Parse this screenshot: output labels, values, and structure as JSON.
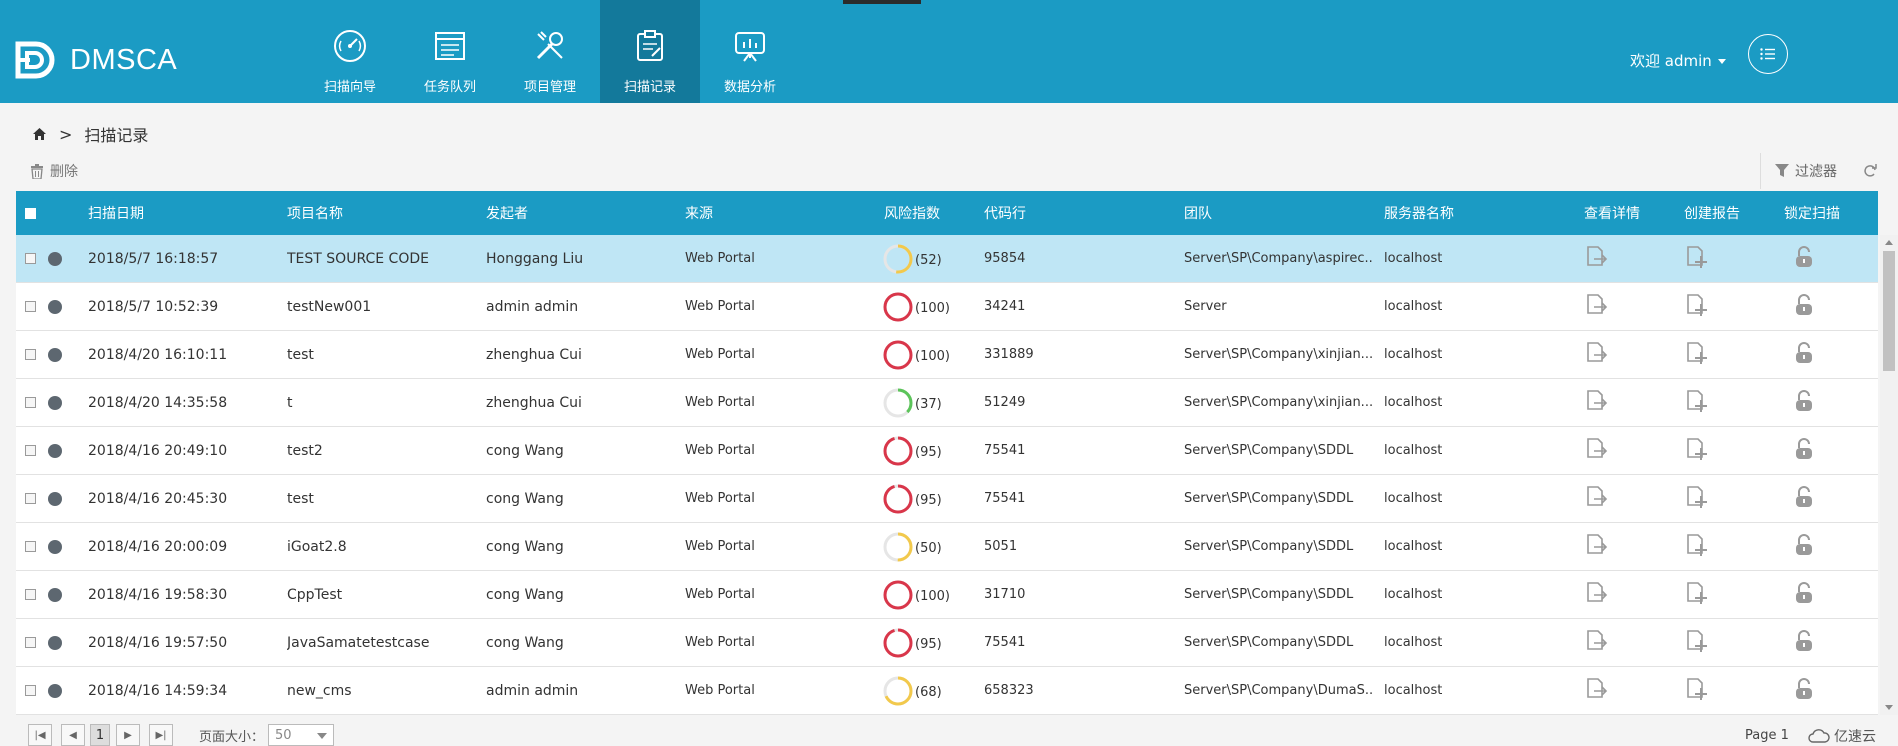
{
  "app": {
    "name": "DMSCA"
  },
  "nav": [
    {
      "label": "扫描向导",
      "icon": "gauge-icon",
      "active": false
    },
    {
      "label": "任务队列",
      "icon": "task-list-icon",
      "active": false
    },
    {
      "label": "项目管理",
      "icon": "tools-icon",
      "active": false
    },
    {
      "label": "扫描记录",
      "icon": "clipboard-edit-icon",
      "active": true
    },
    {
      "label": "数据分析",
      "icon": "presentation-chart-icon",
      "active": false
    }
  ],
  "user": {
    "welcome": "欢迎 admin"
  },
  "breadcrumb": {
    "current": "扫描记录",
    "separator": ">"
  },
  "toolbar": {
    "delete_label": "删除",
    "filter_label": "过滤器"
  },
  "table": {
    "columns": [
      "扫描日期",
      "项目名称",
      "发起者",
      "来源",
      "风险指数",
      "代码行",
      "团队",
      "服务器名称",
      "查看详情",
      "创建报告",
      "锁定扫描"
    ],
    "rows": [
      {
        "date": "2018/5/7 16:18:57",
        "project": "TEST SOURCE CODE",
        "initiator": "Honggang Liu",
        "source": "Web Portal",
        "risk": 52,
        "risk_label": "(52)",
        "risk_color": "#f2c94c",
        "loc": "95854",
        "team": "Server\\SP\\Company\\aspirec...",
        "server": "localhost",
        "selected": true
      },
      {
        "date": "2018/5/7 10:52:39",
        "project": "testNew001",
        "initiator": "admin admin",
        "source": "Web Portal",
        "risk": 100,
        "risk_label": "(100)",
        "risk_color": "#d9364a",
        "loc": "34241",
        "team": "Server",
        "server": "localhost",
        "selected": false
      },
      {
        "date": "2018/4/20 16:10:11",
        "project": "test",
        "initiator": "zhenghua Cui",
        "source": "Web Portal",
        "risk": 100,
        "risk_label": "(100)",
        "risk_color": "#d9364a",
        "loc": "331889",
        "team": "Server\\SP\\Company\\xinjian...",
        "server": "localhost",
        "selected": false
      },
      {
        "date": "2018/4/20 14:35:58",
        "project": "t",
        "initiator": "zhenghua Cui",
        "source": "Web Portal",
        "risk": 37,
        "risk_label": "(37)",
        "risk_color": "#5cc45a",
        "loc": "51249",
        "team": "Server\\SP\\Company\\xinjian...",
        "server": "localhost",
        "selected": false
      },
      {
        "date": "2018/4/16 20:49:10",
        "project": "test2",
        "initiator": "cong Wang",
        "source": "Web Portal",
        "risk": 95,
        "risk_label": "(95)",
        "risk_color": "#d9364a",
        "loc": "75541",
        "team": "Server\\SP\\Company\\SDDL",
        "server": "localhost",
        "selected": false
      },
      {
        "date": "2018/4/16 20:45:30",
        "project": "test",
        "initiator": "cong Wang",
        "source": "Web Portal",
        "risk": 95,
        "risk_label": "(95)",
        "risk_color": "#d9364a",
        "loc": "75541",
        "team": "Server\\SP\\Company\\SDDL",
        "server": "localhost",
        "selected": false
      },
      {
        "date": "2018/4/16 20:00:09",
        "project": "iGoat2.8",
        "initiator": "cong Wang",
        "source": "Web Portal",
        "risk": 50,
        "risk_label": "(50)",
        "risk_color": "#f2c94c",
        "loc": "5051",
        "team": "Server\\SP\\Company\\SDDL",
        "server": "localhost",
        "selected": false
      },
      {
        "date": "2018/4/16 19:58:30",
        "project": "CppTest",
        "initiator": "cong Wang",
        "source": "Web Portal",
        "risk": 100,
        "risk_label": "(100)",
        "risk_color": "#d9364a",
        "loc": "31710",
        "team": "Server\\SP\\Company\\SDDL",
        "server": "localhost",
        "selected": false
      },
      {
        "date": "2018/4/16 19:57:50",
        "project": "JavaSamatetestcase",
        "initiator": "cong Wang",
        "source": "Web Portal",
        "risk": 95,
        "risk_label": "(95)",
        "risk_color": "#d9364a",
        "loc": "75541",
        "team": "Server\\SP\\Company\\SDDL",
        "server": "localhost",
        "selected": false
      },
      {
        "date": "2018/4/16 14:59:34",
        "project": "new_cms",
        "initiator": "admin admin",
        "source": "Web Portal",
        "risk": 68,
        "risk_label": "(68)",
        "risk_color": "#f2c94c",
        "loc": "658323",
        "team": "Server\\SP\\Company\\DumaS...",
        "server": "localhost",
        "selected": false
      }
    ]
  },
  "pager": {
    "current_page": "1",
    "page_size_label": "页面大小：",
    "page_size": "50",
    "page_info": "Page 1"
  },
  "watermark": "亿速云"
}
